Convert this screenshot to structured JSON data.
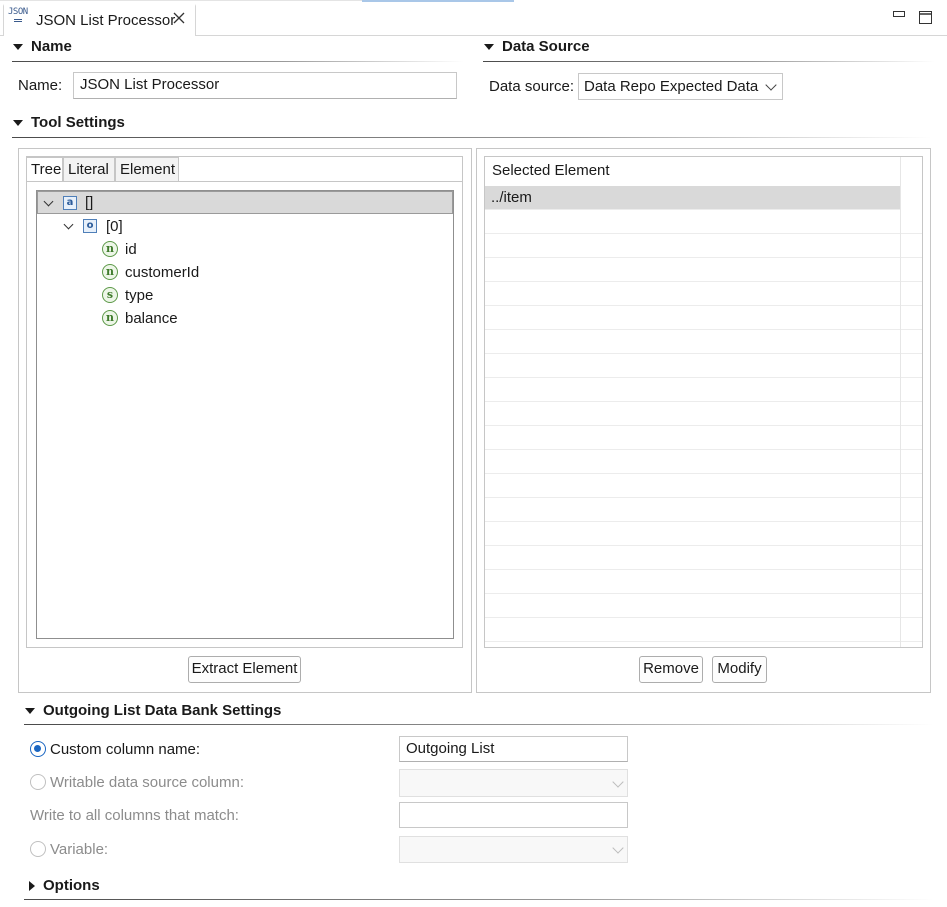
{
  "editor": {
    "tab_title": "JSON List Processor",
    "tab_icon_text": "JSON"
  },
  "name_section": {
    "title": "Name",
    "name_label": "Name:",
    "name_value": "JSON List Processor"
  },
  "data_source_section": {
    "title": "Data Source",
    "label": "Data source:",
    "value": "Data Repo Expected Data"
  },
  "tool_settings": {
    "title": "Tool Settings",
    "tabs": [
      "Tree",
      "Literal",
      "Element"
    ],
    "active_tab": "Tree",
    "tree": {
      "root": {
        "badge": "a",
        "label": "[]"
      },
      "child": {
        "badge": "o",
        "label": "[0]"
      },
      "leaves": [
        {
          "badge": "n",
          "label": "id"
        },
        {
          "badge": "n",
          "label": "customerId"
        },
        {
          "badge": "s",
          "label": "type"
        },
        {
          "badge": "n",
          "label": "balance"
        }
      ]
    },
    "extract_button": "Extract Element",
    "selected_table": {
      "header": "Selected Element",
      "rows": [
        "../item"
      ]
    },
    "remove_button": "Remove",
    "modify_button": "Modify"
  },
  "outgoing": {
    "title": "Outgoing List Data Bank Settings",
    "custom_column_label": "Custom column name:",
    "custom_column_value": "Outgoing List",
    "writable_label": "Writable data source column:",
    "write_all_label": "Write to all columns that match:",
    "variable_label": "Variable:"
  },
  "options": {
    "title": "Options"
  },
  "colors": {
    "radio_accent": "#1a66c2",
    "selection_gray": "#d9d9d9",
    "badge_blue": "#4f7fb8",
    "badge_green": "#5e9a4a"
  }
}
